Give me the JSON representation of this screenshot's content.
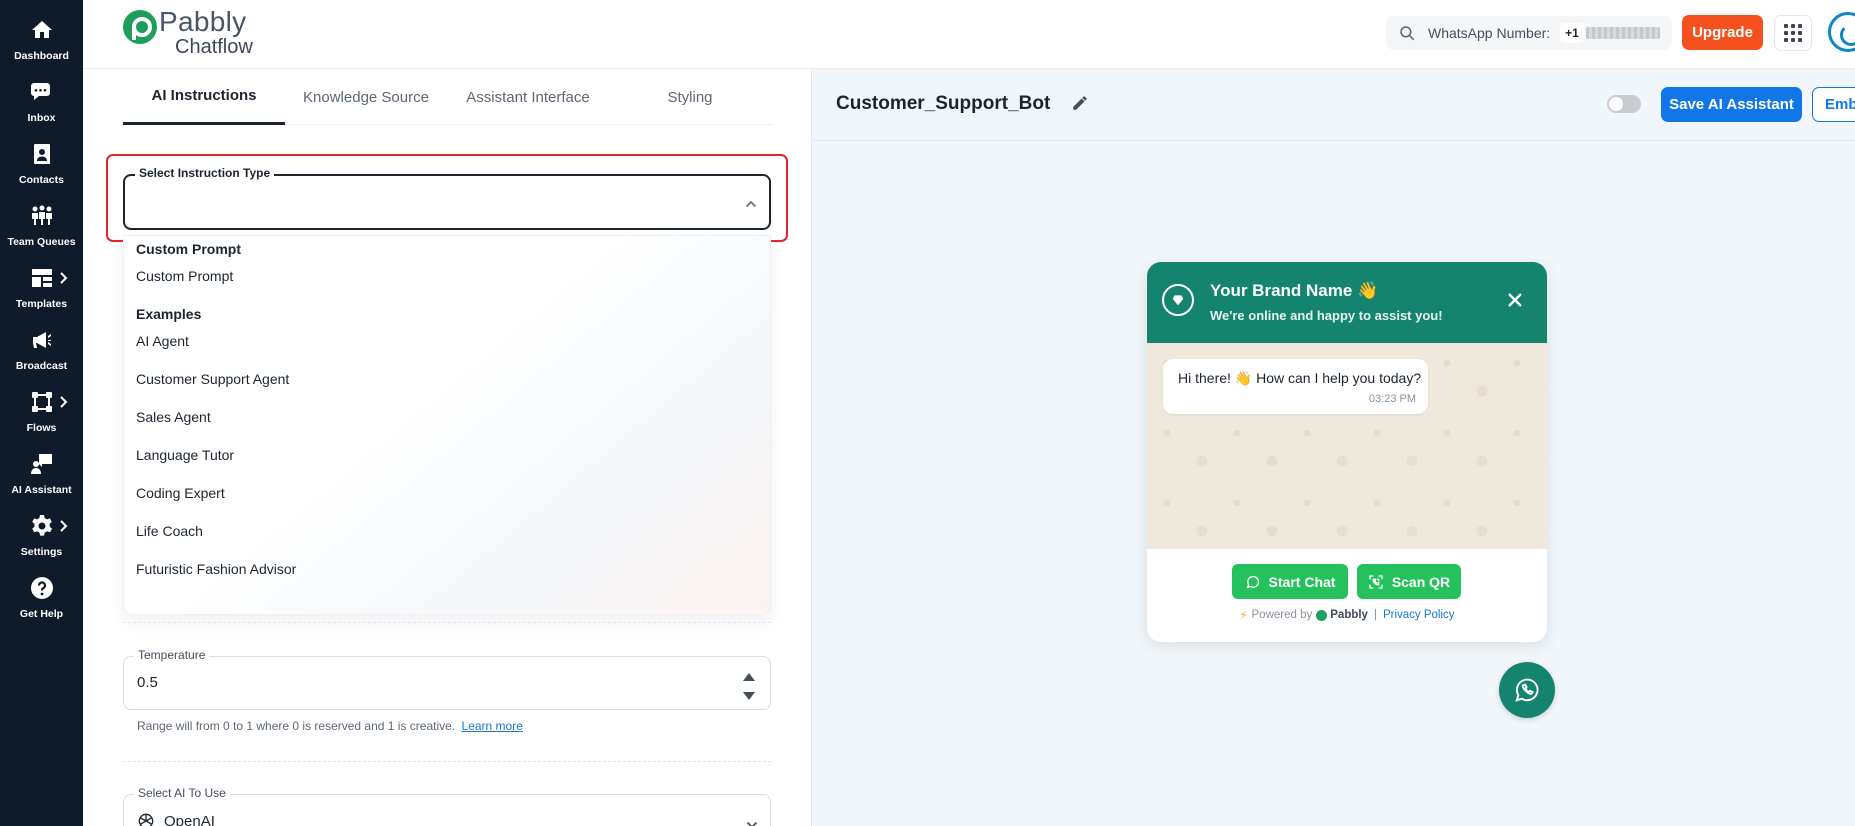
{
  "sidebar": {
    "items": [
      {
        "label": "Dashboard",
        "icon": "home-icon"
      },
      {
        "label": "Inbox",
        "icon": "chat-icon"
      },
      {
        "label": "Contacts",
        "icon": "contact-card-icon"
      },
      {
        "label": "Team Queues",
        "icon": "team-icon"
      },
      {
        "label": "Templates",
        "icon": "template-icon"
      },
      {
        "label": "Broadcast",
        "icon": "megaphone-icon"
      },
      {
        "label": "Flows",
        "icon": "flow-icon"
      },
      {
        "label": "AI Assistant",
        "icon": "ai-assistant-icon"
      },
      {
        "label": "Settings",
        "icon": "gear-icon"
      },
      {
        "label": "Get Help",
        "icon": "help-icon"
      }
    ]
  },
  "header": {
    "logo_line1": "Pabbly",
    "logo_line2": "Chatflow",
    "wa_label": "WhatsApp Number:",
    "wa_code": "+1",
    "upgrade_label": "Upgrade"
  },
  "tabs": [
    {
      "label": "AI Instructions"
    },
    {
      "label": "Knowledge Source"
    },
    {
      "label": "Assistant Interface"
    },
    {
      "label": "Styling"
    }
  ],
  "instruction_select": {
    "label": "Select Instruction Type",
    "value": ""
  },
  "dropdown": {
    "group1": "Custom Prompt",
    "group1_items": [
      "Custom Prompt"
    ],
    "group2": "Examples",
    "group2_items": [
      "AI Agent",
      "Customer Support Agent",
      "Sales Agent",
      "Language Tutor",
      "Coding Expert",
      "Life Coach",
      "Futuristic Fashion Advisor"
    ]
  },
  "temperature": {
    "label": "Temperature",
    "value": "0.5",
    "helper": "Range will from 0 to 1 where 0 is reserved and 1 is creative.",
    "learn_more": "Learn more"
  },
  "ai_select": {
    "label": "Select AI To Use",
    "value": "OpenAI"
  },
  "right": {
    "bot_name": "Customer_Support_Bot",
    "save_label": "Save AI Assistant",
    "embed_label": "Embed"
  },
  "widget": {
    "brand_name": "Your Brand Name 👋",
    "brand_sub": "We're online and happy to assist you!",
    "message": "Hi there! 👋 How can I help you today?",
    "time": "03:23 PM",
    "start_chat": "Start Chat",
    "scan_qr": "Scan QR",
    "powered_by": "Powered by",
    "powered_brand": "Pabbly",
    "privacy": "Privacy Policy"
  },
  "colors": {
    "sidebar_bg": "#0f1a2a",
    "accent_blue": "#1176e8",
    "upgrade_orange": "#f4511e",
    "widget_green": "#14846f",
    "button_green": "#25c15c",
    "highlight_red": "#e5232c"
  }
}
